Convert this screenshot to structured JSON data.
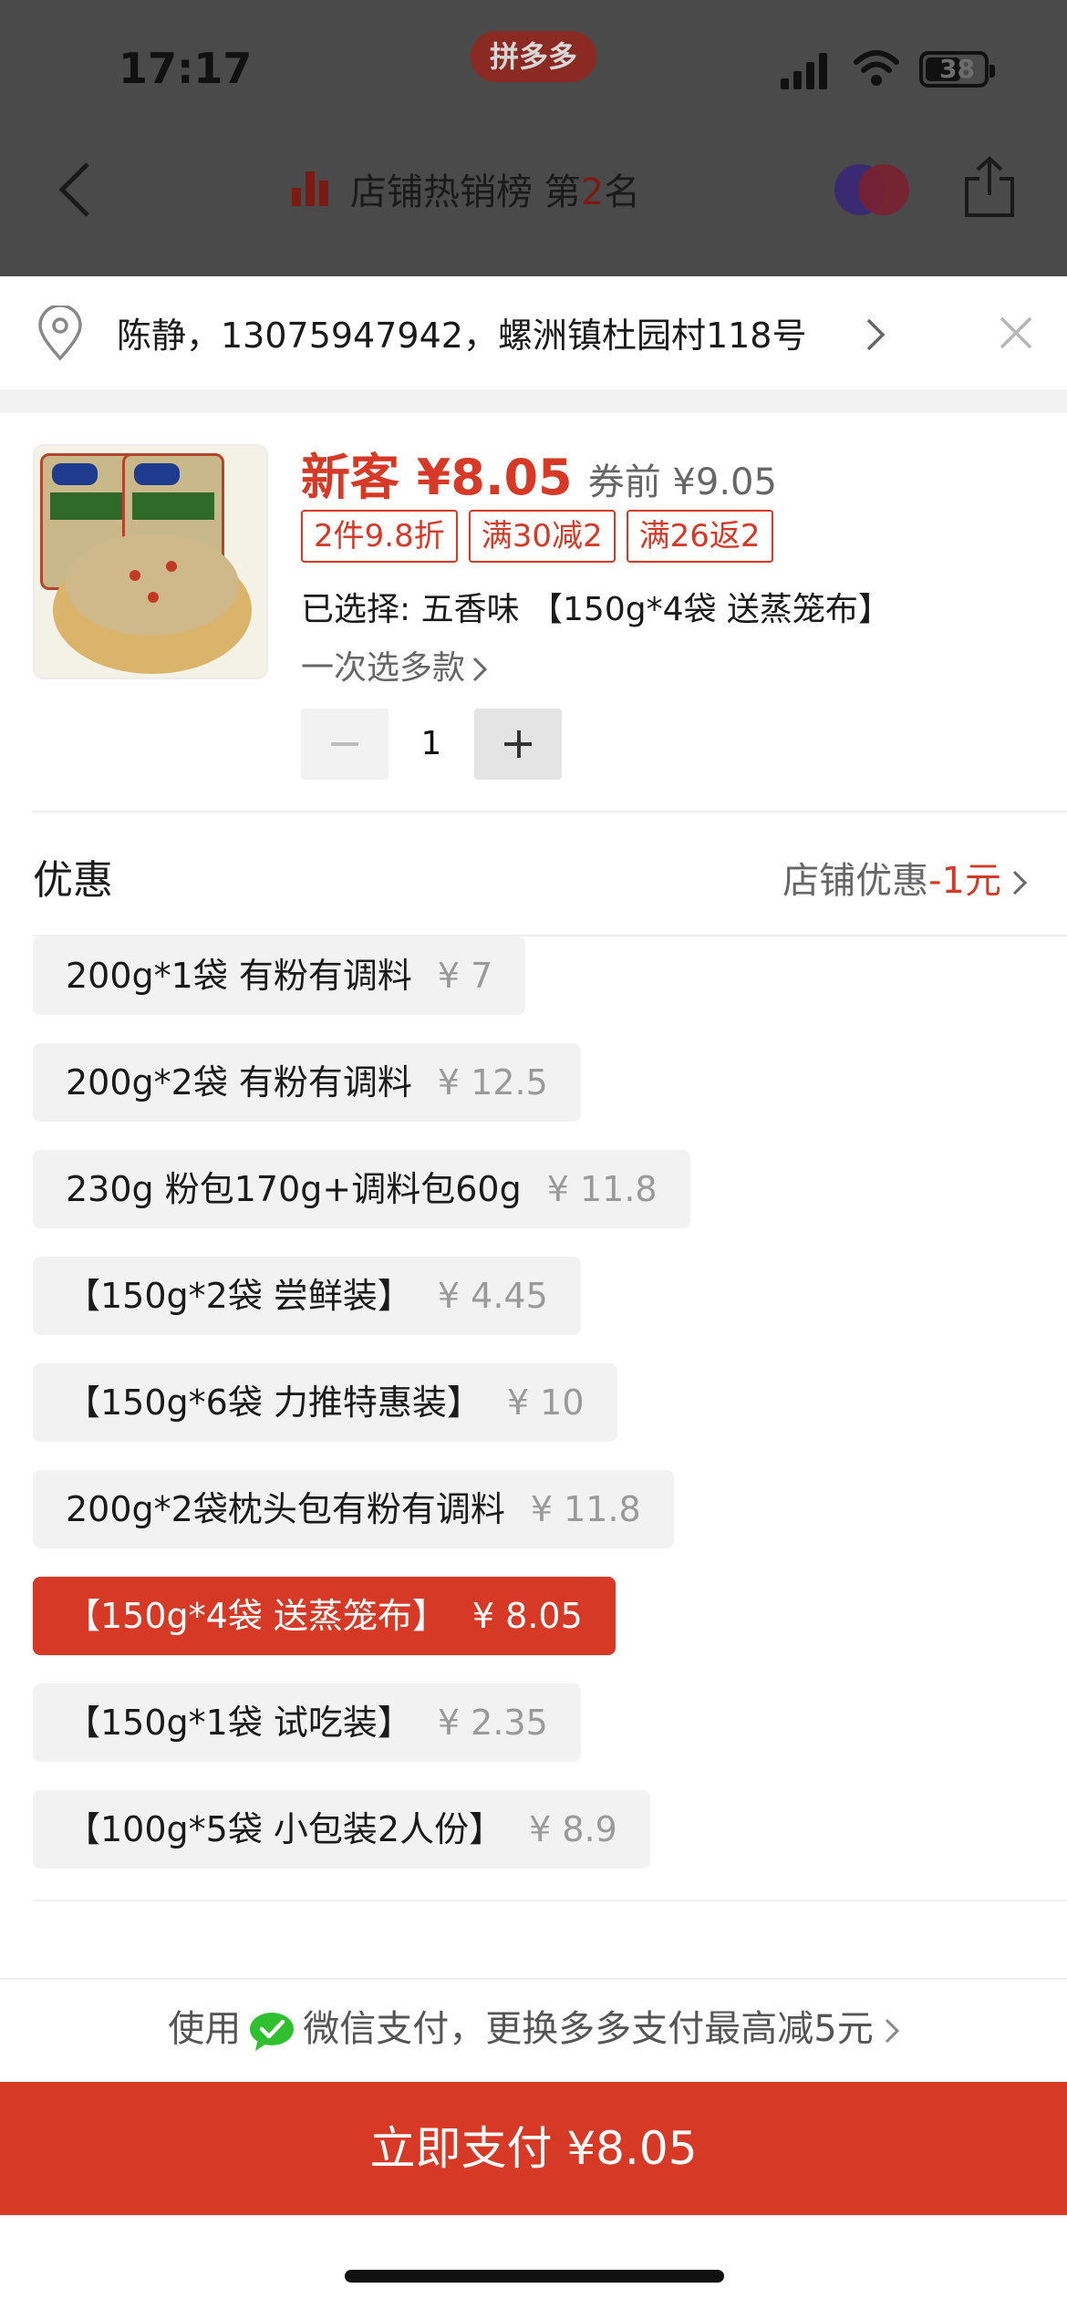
{
  "status_bar": {
    "time": "17:17",
    "app_badge": "拼多多",
    "battery": "38"
  },
  "nav": {
    "rank_prefix": "店铺热销榜 第",
    "rank_num": "2",
    "rank_suffix": "名"
  },
  "address": {
    "text": "陈静，13075947942，螺洲镇杜园村118号"
  },
  "product": {
    "new_price": "新客 ¥8.05",
    "old_price": "券前 ¥9.05",
    "tags": [
      "2件9.8折",
      "满30减2",
      "满26返2"
    ],
    "selected": "已选择: 五香味 【150g*4袋 送蒸笼布】",
    "multi_select": "一次选多款",
    "quantity": "1"
  },
  "discount": {
    "label": "优惠",
    "right_text": "店铺优惠",
    "right_value": "-1元"
  },
  "options": [
    {
      "label": "200g*1袋 有粉有调料",
      "price": "¥ 7"
    },
    {
      "label": "200g*2袋 有粉有调料",
      "price": "¥ 12.5"
    },
    {
      "label": "230g 粉包170g+调料包60g",
      "price": "¥ 11.8"
    },
    {
      "label": "【150g*2袋 尝鲜装】",
      "price": "¥ 4.45"
    },
    {
      "label": "【150g*6袋 力推特惠装】",
      "price": "¥ 10"
    },
    {
      "label": "200g*2袋枕头包有粉有调料",
      "price": "¥ 11.8"
    },
    {
      "label": "【150g*4袋 送蒸笼布】",
      "price": "¥ 8.05"
    },
    {
      "label": "【150g*1袋 试吃装】",
      "price": "¥ 2.35"
    },
    {
      "label": "【100g*5袋 小包装2人份】",
      "price": "¥ 8.9"
    }
  ],
  "payment": {
    "use": "使用",
    "wechat_text": "微信支付，更换多多支付最高减5元",
    "pay_button": "立即支付 ¥8.05"
  },
  "colors": {
    "accent": "#d63a27",
    "wechat_green": "#2fbf2f"
  }
}
